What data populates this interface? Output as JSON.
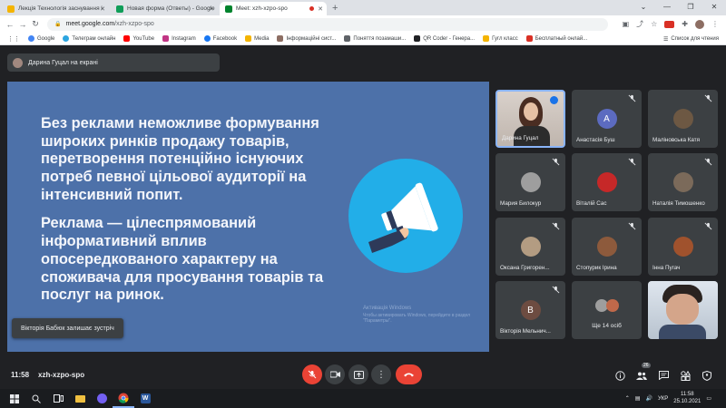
{
  "browser": {
    "tabs": [
      {
        "label": "Лекція Технологія заснування і",
        "favicon_color": "#f4b400",
        "active": false
      },
      {
        "label": "Новая форма (Ответы) - Google",
        "favicon_color": "#0f9d58",
        "active": false
      },
      {
        "label": "Meet: xzh-xzpo-spo",
        "favicon_color": "#00832d",
        "active": true
      }
    ],
    "new_tab": "+",
    "url_host": "meet.google.com",
    "url_path": "/xzh-xzpo-spo",
    "bookmarks": [
      {
        "label": "Google",
        "color": "#4285f4"
      },
      {
        "label": "Телеграм онлайн",
        "color": "#2ca5e0"
      },
      {
        "label": "YouTube",
        "color": "#ff0000"
      },
      {
        "label": "Instagram",
        "color": "#c13584"
      },
      {
        "label": "Facebook",
        "color": "#1877f2"
      },
      {
        "label": "Media",
        "color": "#f4b400"
      },
      {
        "label": "Інформаційні сист...",
        "color": "#8d6e63"
      },
      {
        "label": "Поняття позамаши...",
        "color": "#5f6368"
      },
      {
        "label": "QR Coder - Генера...",
        "color": "#202124"
      },
      {
        "label": "Гугл класс",
        "color": "#f4b400"
      },
      {
        "label": "Бесплатный онлай...",
        "color": "#d93025"
      }
    ],
    "reading_list": "Список для чтения"
  },
  "meet": {
    "presenter_label": "Дарина Гуцал на екрані",
    "slide": {
      "paragraph1": "Без реклами неможливе формування широких ринків продажу товарів, перетворення потенційно існуючих потреб певної цільової аудиторії на інтенсивний попит.",
      "paragraph2": "Реклама — цілеспрямований інформативний вплив опосередкованого характеру на споживача для просування товарів та послуг на ринок.",
      "watermark_line1": "Активація Windows",
      "watermark_line2": "Чтобы активировать Windows, перейдите в раздел",
      "watermark_line3": "\"Параметры\"."
    },
    "toast": "Вікторія Бабюк залишає зустріч",
    "participants": [
      {
        "name": "Дарина Гуцал",
        "kind": "speaking"
      },
      {
        "name": "Анастасія Буш",
        "kind": "letter",
        "letter": "A",
        "color": "#5c6bc0"
      },
      {
        "name": "Маліновська Катя",
        "kind": "photo",
        "color": "#6d5843"
      },
      {
        "name": "Мария Билокур",
        "kind": "photo",
        "color": "#9e9e9e"
      },
      {
        "name": "Віталій Сас",
        "kind": "photo",
        "color": "#c62828"
      },
      {
        "name": "Наталія Тимошенко",
        "kind": "photo",
        "color": "#7b6a5a"
      },
      {
        "name": "Оксана Григорен...",
        "kind": "photo",
        "color": "#b39c82"
      },
      {
        "name": "Стопурик Ірина",
        "kind": "photo",
        "color": "#8d5a3c"
      },
      {
        "name": "Інна Пугач",
        "kind": "photo",
        "color": "#a0522d"
      },
      {
        "name": "Вікторія Мельнич...",
        "kind": "letter",
        "letter": "В",
        "color": "#6d4c41"
      },
      {
        "name": "Ще 14 осіб",
        "kind": "more"
      },
      {
        "name": "",
        "kind": "camera"
      }
    ],
    "time": "11:58",
    "meeting_code": "xzh-xzpo-spo",
    "people_count": "26"
  },
  "taskbar": {
    "lang": "УКР",
    "time": "11:58",
    "date": "25.10.2021"
  }
}
